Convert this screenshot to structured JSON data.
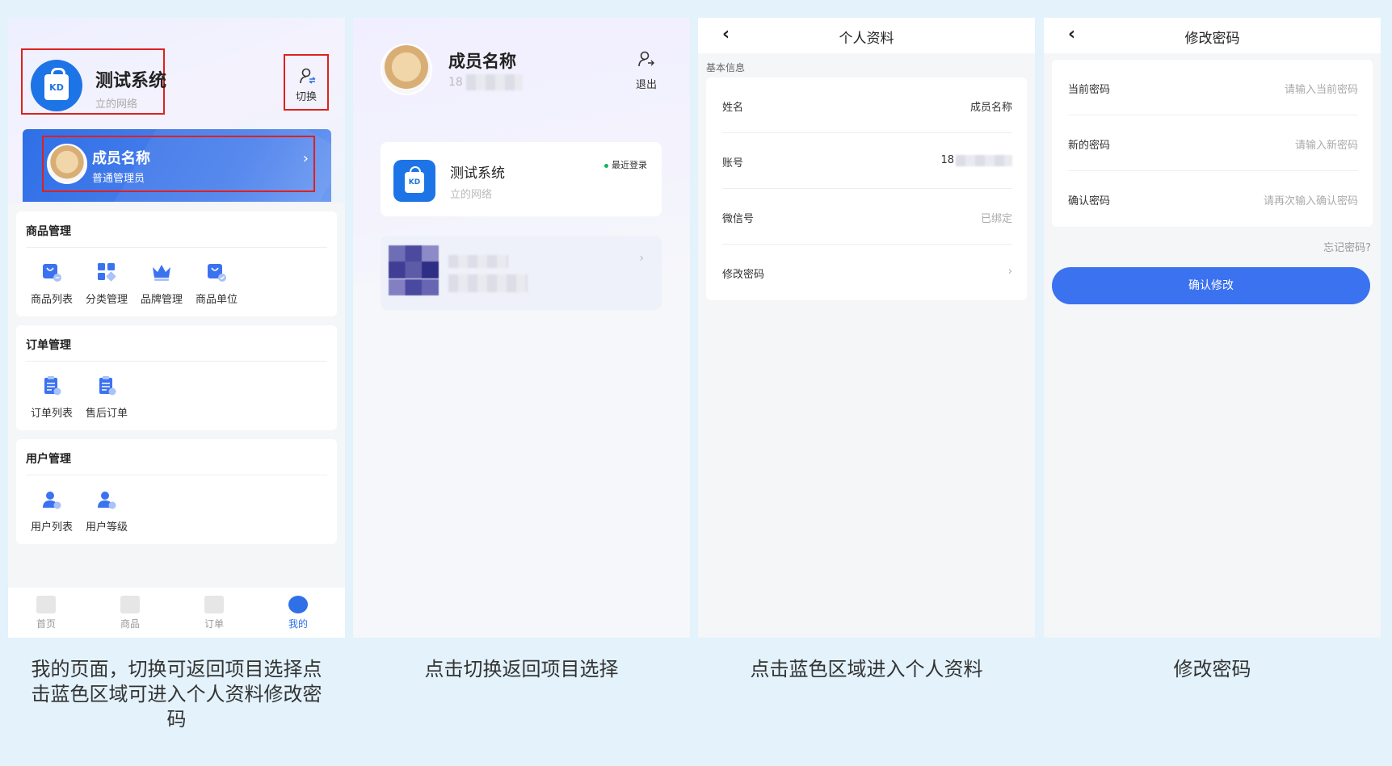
{
  "screen1": {
    "system_name": "测试系统",
    "system_subtitle": "立的网络",
    "switch_label": "切换",
    "member_name": "成员名称",
    "member_role": "普通管理员",
    "sections": [
      {
        "title": "商品管理",
        "items": [
          "商品列表",
          "分类管理",
          "品牌管理",
          "商品单位"
        ]
      },
      {
        "title": "订单管理",
        "items": [
          "订单列表",
          "售后订单"
        ]
      },
      {
        "title": "用户管理",
        "items": [
          "用户列表",
          "用户等级"
        ]
      }
    ],
    "tabs": [
      "首页",
      "商品",
      "订单",
      "我的"
    ],
    "active_tab": 3
  },
  "screen2": {
    "member_name": "成员名称",
    "phone_prefix": "18",
    "logout_label": "退出",
    "project_name": "测试系统",
    "project_subtitle": "立的网络",
    "project_badge": "最近登录"
  },
  "screen3": {
    "back": "‹",
    "title": "个人资料",
    "section_hint": "基本信息",
    "rows": [
      {
        "label": "姓名",
        "value": "成员名称"
      },
      {
        "label": "账号",
        "value": "18"
      },
      {
        "label": "微信号",
        "value": "已绑定"
      },
      {
        "label": "修改密码",
        "value": "›"
      }
    ]
  },
  "screen4": {
    "back": "‹",
    "title": "修改密码",
    "rows": [
      {
        "label": "当前密码",
        "placeholder": "请输入当前密码"
      },
      {
        "label": "新的密码",
        "placeholder": "请输入新密码"
      },
      {
        "label": "确认密码",
        "placeholder": "请再次输入确认密码"
      }
    ],
    "forgot": "忘记密码?",
    "confirm": "确认修改"
  },
  "captions": [
    "我的页面，切换可返回项目选择点击蓝色区域可进入个人资料修改密码",
    "点击切换返回项目选择",
    "点击蓝色区域进入个人资料",
    "修改密码"
  ],
  "colors": {
    "primary": "#3b72f0",
    "logo": "#1d74e6",
    "highlight_border": "#e02020",
    "online": "#18b35a",
    "background": "#e3f2fb"
  }
}
